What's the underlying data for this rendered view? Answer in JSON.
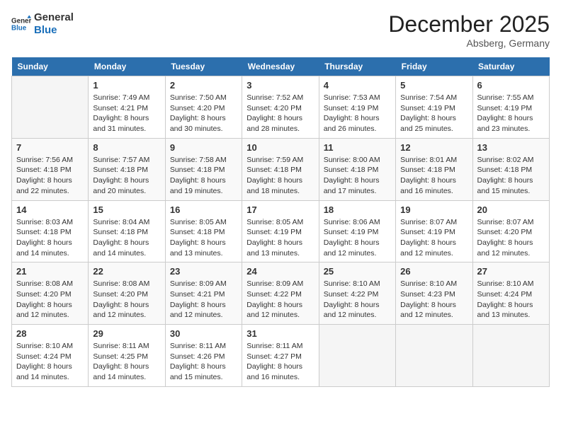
{
  "header": {
    "logo_line1": "General",
    "logo_line2": "Blue",
    "month": "December 2025",
    "location": "Absberg, Germany"
  },
  "days_of_week": [
    "Sunday",
    "Monday",
    "Tuesday",
    "Wednesday",
    "Thursday",
    "Friday",
    "Saturday"
  ],
  "weeks": [
    [
      {
        "num": "",
        "info": ""
      },
      {
        "num": "1",
        "info": "Sunrise: 7:49 AM\nSunset: 4:21 PM\nDaylight: 8 hours\nand 31 minutes."
      },
      {
        "num": "2",
        "info": "Sunrise: 7:50 AM\nSunset: 4:20 PM\nDaylight: 8 hours\nand 30 minutes."
      },
      {
        "num": "3",
        "info": "Sunrise: 7:52 AM\nSunset: 4:20 PM\nDaylight: 8 hours\nand 28 minutes."
      },
      {
        "num": "4",
        "info": "Sunrise: 7:53 AM\nSunset: 4:19 PM\nDaylight: 8 hours\nand 26 minutes."
      },
      {
        "num": "5",
        "info": "Sunrise: 7:54 AM\nSunset: 4:19 PM\nDaylight: 8 hours\nand 25 minutes."
      },
      {
        "num": "6",
        "info": "Sunrise: 7:55 AM\nSunset: 4:19 PM\nDaylight: 8 hours\nand 23 minutes."
      }
    ],
    [
      {
        "num": "7",
        "info": "Sunrise: 7:56 AM\nSunset: 4:18 PM\nDaylight: 8 hours\nand 22 minutes."
      },
      {
        "num": "8",
        "info": "Sunrise: 7:57 AM\nSunset: 4:18 PM\nDaylight: 8 hours\nand 20 minutes."
      },
      {
        "num": "9",
        "info": "Sunrise: 7:58 AM\nSunset: 4:18 PM\nDaylight: 8 hours\nand 19 minutes."
      },
      {
        "num": "10",
        "info": "Sunrise: 7:59 AM\nSunset: 4:18 PM\nDaylight: 8 hours\nand 18 minutes."
      },
      {
        "num": "11",
        "info": "Sunrise: 8:00 AM\nSunset: 4:18 PM\nDaylight: 8 hours\nand 17 minutes."
      },
      {
        "num": "12",
        "info": "Sunrise: 8:01 AM\nSunset: 4:18 PM\nDaylight: 8 hours\nand 16 minutes."
      },
      {
        "num": "13",
        "info": "Sunrise: 8:02 AM\nSunset: 4:18 PM\nDaylight: 8 hours\nand 15 minutes."
      }
    ],
    [
      {
        "num": "14",
        "info": "Sunrise: 8:03 AM\nSunset: 4:18 PM\nDaylight: 8 hours\nand 14 minutes."
      },
      {
        "num": "15",
        "info": "Sunrise: 8:04 AM\nSunset: 4:18 PM\nDaylight: 8 hours\nand 14 minutes."
      },
      {
        "num": "16",
        "info": "Sunrise: 8:05 AM\nSunset: 4:18 PM\nDaylight: 8 hours\nand 13 minutes."
      },
      {
        "num": "17",
        "info": "Sunrise: 8:05 AM\nSunset: 4:19 PM\nDaylight: 8 hours\nand 13 minutes."
      },
      {
        "num": "18",
        "info": "Sunrise: 8:06 AM\nSunset: 4:19 PM\nDaylight: 8 hours\nand 12 minutes."
      },
      {
        "num": "19",
        "info": "Sunrise: 8:07 AM\nSunset: 4:19 PM\nDaylight: 8 hours\nand 12 minutes."
      },
      {
        "num": "20",
        "info": "Sunrise: 8:07 AM\nSunset: 4:20 PM\nDaylight: 8 hours\nand 12 minutes."
      }
    ],
    [
      {
        "num": "21",
        "info": "Sunrise: 8:08 AM\nSunset: 4:20 PM\nDaylight: 8 hours\nand 12 minutes."
      },
      {
        "num": "22",
        "info": "Sunrise: 8:08 AM\nSunset: 4:20 PM\nDaylight: 8 hours\nand 12 minutes."
      },
      {
        "num": "23",
        "info": "Sunrise: 8:09 AM\nSunset: 4:21 PM\nDaylight: 8 hours\nand 12 minutes."
      },
      {
        "num": "24",
        "info": "Sunrise: 8:09 AM\nSunset: 4:22 PM\nDaylight: 8 hours\nand 12 minutes."
      },
      {
        "num": "25",
        "info": "Sunrise: 8:10 AM\nSunset: 4:22 PM\nDaylight: 8 hours\nand 12 minutes."
      },
      {
        "num": "26",
        "info": "Sunrise: 8:10 AM\nSunset: 4:23 PM\nDaylight: 8 hours\nand 12 minutes."
      },
      {
        "num": "27",
        "info": "Sunrise: 8:10 AM\nSunset: 4:24 PM\nDaylight: 8 hours\nand 13 minutes."
      }
    ],
    [
      {
        "num": "28",
        "info": "Sunrise: 8:10 AM\nSunset: 4:24 PM\nDaylight: 8 hours\nand 14 minutes."
      },
      {
        "num": "29",
        "info": "Sunrise: 8:11 AM\nSunset: 4:25 PM\nDaylight: 8 hours\nand 14 minutes."
      },
      {
        "num": "30",
        "info": "Sunrise: 8:11 AM\nSunset: 4:26 PM\nDaylight: 8 hours\nand 15 minutes."
      },
      {
        "num": "31",
        "info": "Sunrise: 8:11 AM\nSunset: 4:27 PM\nDaylight: 8 hours\nand 16 minutes."
      },
      {
        "num": "",
        "info": ""
      },
      {
        "num": "",
        "info": ""
      },
      {
        "num": "",
        "info": ""
      }
    ]
  ]
}
